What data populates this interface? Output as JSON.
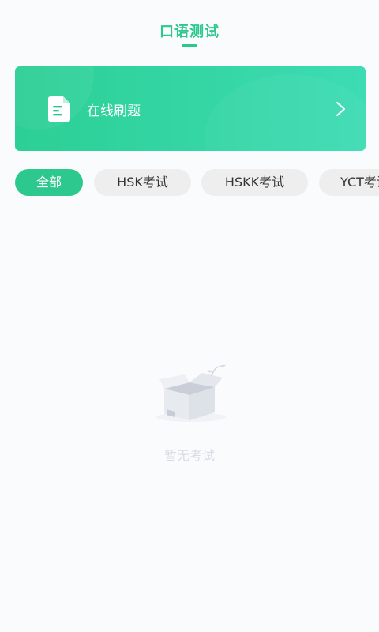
{
  "header": {
    "title": "口语测试"
  },
  "banner": {
    "label": "在线刷题",
    "icon": "document-icon",
    "chevron_icon": "chevron-right-icon"
  },
  "tabs": [
    {
      "label": "全部",
      "active": true
    },
    {
      "label": "HSK考试",
      "active": false
    },
    {
      "label": "HSKK考试",
      "active": false
    },
    {
      "label": "YCT考试",
      "active": false
    }
  ],
  "empty": {
    "text": "暂无考试",
    "icon": "empty-box-icon"
  },
  "colors": {
    "accent": "#2dc88e",
    "tab_inactive_bg": "#eeeeee",
    "empty_text": "#d6dce6"
  }
}
